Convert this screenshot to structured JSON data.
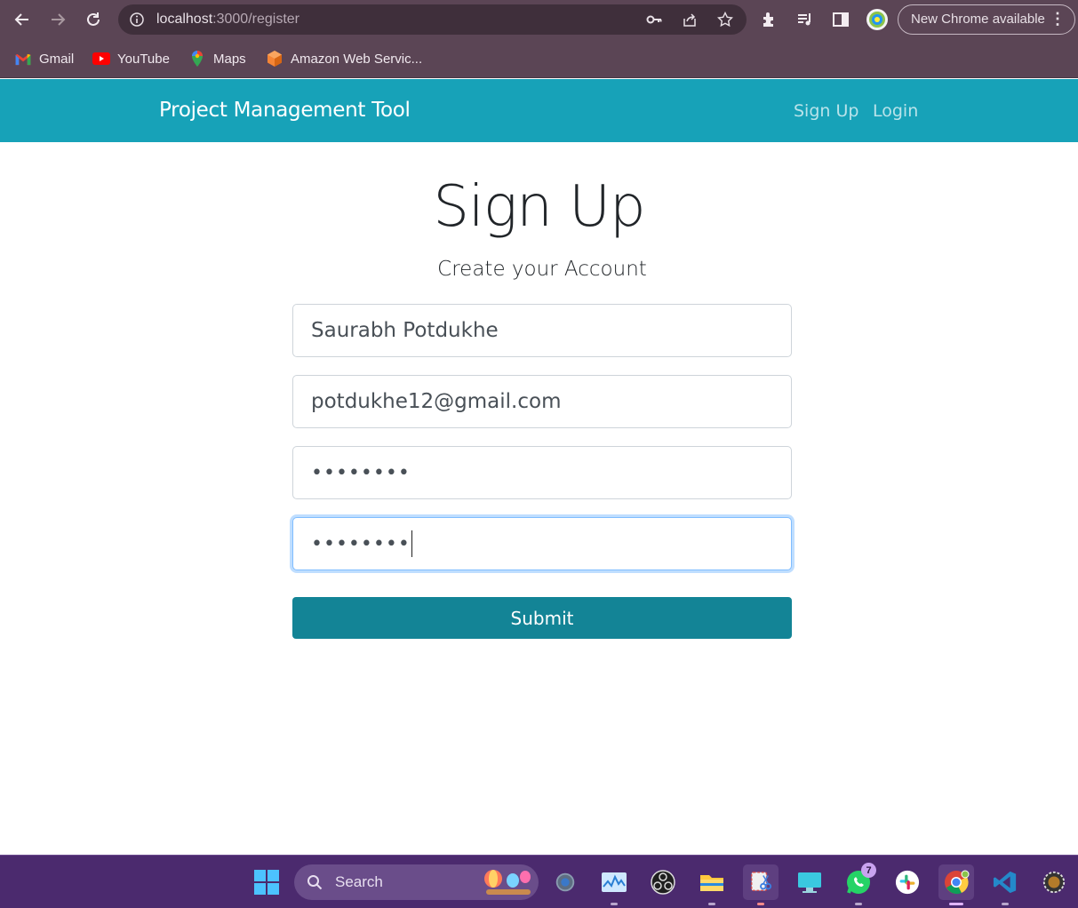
{
  "browser": {
    "url_host": "localhost",
    "url_path": ":3000/register",
    "update_button": "New Chrome available",
    "icons": [
      "back-icon",
      "forward-icon",
      "reload-icon",
      "info-icon",
      "key-icon",
      "share-icon",
      "star-icon",
      "extensions-icon",
      "media-icon",
      "sidepanel-icon",
      "profile-icon",
      "menu-icon"
    ]
  },
  "bookmarks": [
    {
      "label": "Gmail",
      "icon": "gmail-icon"
    },
    {
      "label": "YouTube",
      "icon": "youtube-icon"
    },
    {
      "label": "Maps",
      "icon": "maps-icon"
    },
    {
      "label": "Amazon Web Servic...",
      "icon": "aws-icon"
    }
  ],
  "navbar": {
    "brand": "Project Management Tool",
    "links": [
      "Sign Up",
      "Login"
    ],
    "background": "#17a2b8"
  },
  "form": {
    "title": "Sign Up",
    "subtitle": "Create your Account",
    "fullname_value": "Saurabh Potdukhe",
    "email_value": "potdukhe12@gmail.com",
    "password_value": "••••••••",
    "confirm_password_value": "••••••••",
    "submit_label": "Submit",
    "submit_color": "#138496"
  },
  "taskbar": {
    "search_label": "Search",
    "whatsapp_badge": "7",
    "background": "#4b2a6e"
  }
}
